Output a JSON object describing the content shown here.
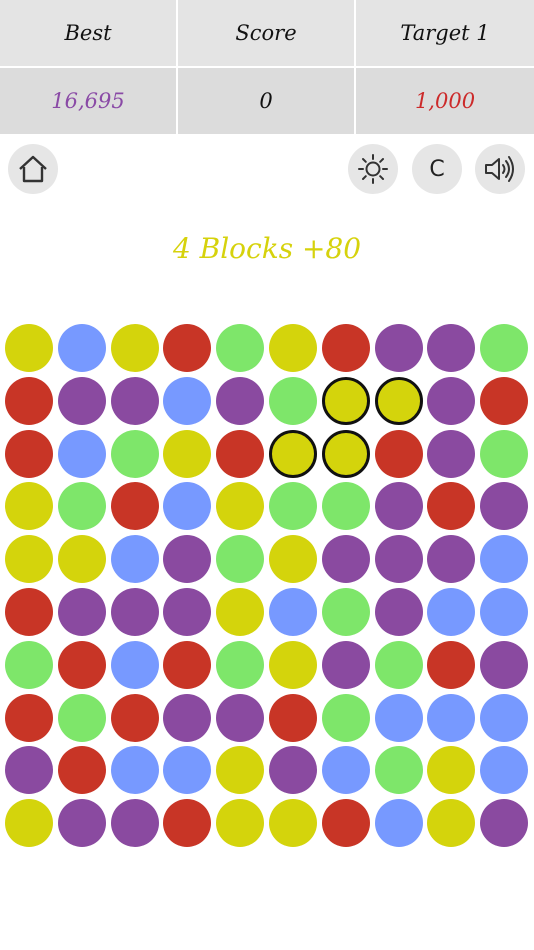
{
  "scoreboard": {
    "best_label": "Best",
    "score_label": "Score",
    "target_label": "Target 1",
    "best_value": "16,695",
    "score_value": "0",
    "target_value": "1,000",
    "best_color": "#8a4aa6",
    "score_color": "#111111",
    "target_color": "#cc2a2a"
  },
  "toolbar": {
    "home_icon": "home-icon",
    "brightness_icon": "brightness-icon",
    "clear_label": "C",
    "sound_icon": "speaker-volume-icon"
  },
  "status_message": "4 Blocks +80",
  "colors": {
    "Y": "#d4d40c",
    "B": "#7799ff",
    "R": "#c83526",
    "G": "#7ee66a",
    "P": "#8a4aa0"
  },
  "board": {
    "rows": [
      [
        "Y",
        "B",
        "Y",
        "R",
        "G",
        "Y",
        "R",
        "P",
        "P",
        "G"
      ],
      [
        "R",
        "P",
        "P",
        "B",
        "P",
        "G",
        "Y",
        "Y",
        "P",
        "R"
      ],
      [
        "R",
        "B",
        "G",
        "Y",
        "R",
        "Y",
        "Y",
        "R",
        "P",
        "G"
      ],
      [
        "Y",
        "G",
        "R",
        "B",
        "Y",
        "G",
        "G",
        "P",
        "R",
        "P"
      ],
      [
        "Y",
        "Y",
        "B",
        "P",
        "G",
        "Y",
        "P",
        "P",
        "P",
        "B"
      ],
      [
        "R",
        "P",
        "P",
        "P",
        "Y",
        "B",
        "G",
        "P",
        "B",
        "B"
      ],
      [
        "G",
        "R",
        "B",
        "R",
        "G",
        "Y",
        "P",
        "G",
        "R",
        "P"
      ],
      [
        "R",
        "G",
        "R",
        "P",
        "P",
        "R",
        "G",
        "B",
        "B",
        "B"
      ],
      [
        "P",
        "R",
        "B",
        "B",
        "Y",
        "P",
        "B",
        "G",
        "Y",
        "B"
      ],
      [
        "Y",
        "P",
        "P",
        "R",
        "Y",
        "Y",
        "R",
        "B",
        "Y",
        "P"
      ]
    ],
    "selected": [
      [
        1,
        6
      ],
      [
        1,
        7
      ],
      [
        2,
        5
      ],
      [
        2,
        6
      ]
    ]
  }
}
